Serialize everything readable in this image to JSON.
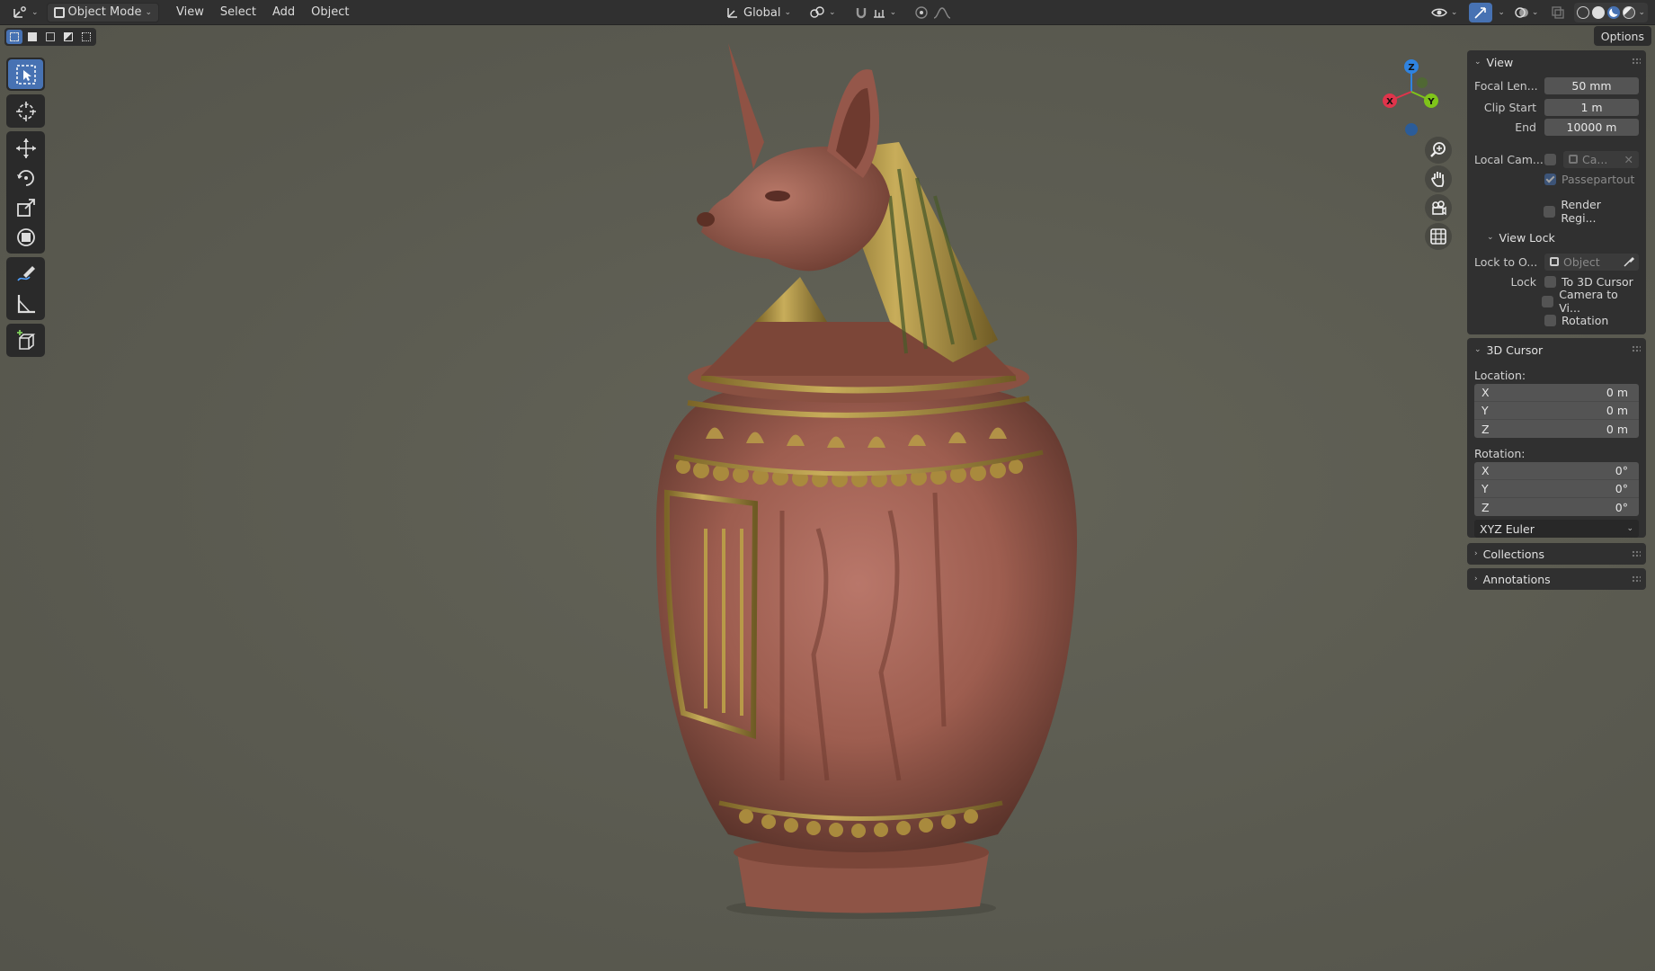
{
  "header": {
    "mode_label": "Object Mode",
    "menus": [
      "View",
      "Select",
      "Add",
      "Object"
    ],
    "transform_orientation": "Global"
  },
  "options_label": "Options",
  "sidebar": {
    "view": {
      "title": "View",
      "focal_length_label": "Focal Len...",
      "focal_length_value": "50 mm",
      "clip_start_label": "Clip Start",
      "clip_start_value": "1 m",
      "clip_end_label": "End",
      "clip_end_value": "10000 m",
      "local_camera_label": "Local Cam...",
      "local_camera_value": "Ca...",
      "passepartout_label": "Passepartout",
      "render_region_label": "Render Regi...",
      "view_lock_title": "View Lock",
      "lock_to_object_label": "Lock to O...",
      "lock_to_object_placeholder": "Object",
      "lock_label": "Lock",
      "lock_3d_cursor_label": "To 3D Cursor",
      "lock_camera_label": "Camera to Vi...",
      "lock_rotation_label": "Rotation"
    },
    "cursor": {
      "title": "3D Cursor",
      "location_label": "Location:",
      "location": [
        {
          "axis": "X",
          "value": "0 m"
        },
        {
          "axis": "Y",
          "value": "0 m"
        },
        {
          "axis": "Z",
          "value": "0 m"
        }
      ],
      "rotation_label": "Rotation:",
      "rotation": [
        {
          "axis": "X",
          "value": "0°"
        },
        {
          "axis": "Y",
          "value": "0°"
        },
        {
          "axis": "Z",
          "value": "0°"
        }
      ],
      "rotation_mode": "XYZ Euler"
    },
    "collections_title": "Collections",
    "annotations_title": "Annotations"
  },
  "gizmo": {
    "x": "X",
    "y": "Y",
    "z": "Z"
  },
  "colors": {
    "accent": "#4772b3",
    "axis_x": "#e0344b",
    "axis_y": "#7fc41a",
    "axis_z": "#2f83e0"
  }
}
